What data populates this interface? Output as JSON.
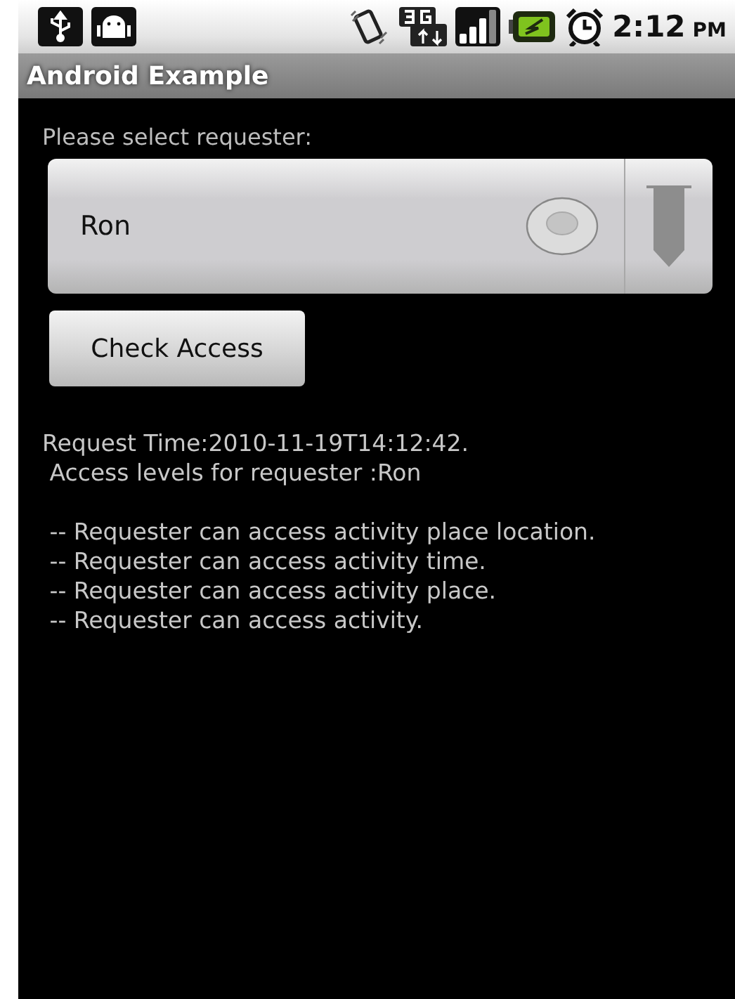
{
  "status_bar": {
    "time": "2:12",
    "ampm": "PM"
  },
  "title_bar": {
    "title": "Android Example"
  },
  "form": {
    "prompt": "Please select requester:",
    "spinner": {
      "value": "Ron"
    },
    "button": "Check Access"
  },
  "result": {
    "header_lines": [
      "Request Time:2010-11-19T14:12:42.",
      " Access levels for requester :Ron"
    ],
    "access_lines": [
      " -- Requester can access activity place location.",
      " -- Requester can access activity time.",
      " -- Requester can access activity place.",
      " -- Requester can access activity."
    ]
  }
}
